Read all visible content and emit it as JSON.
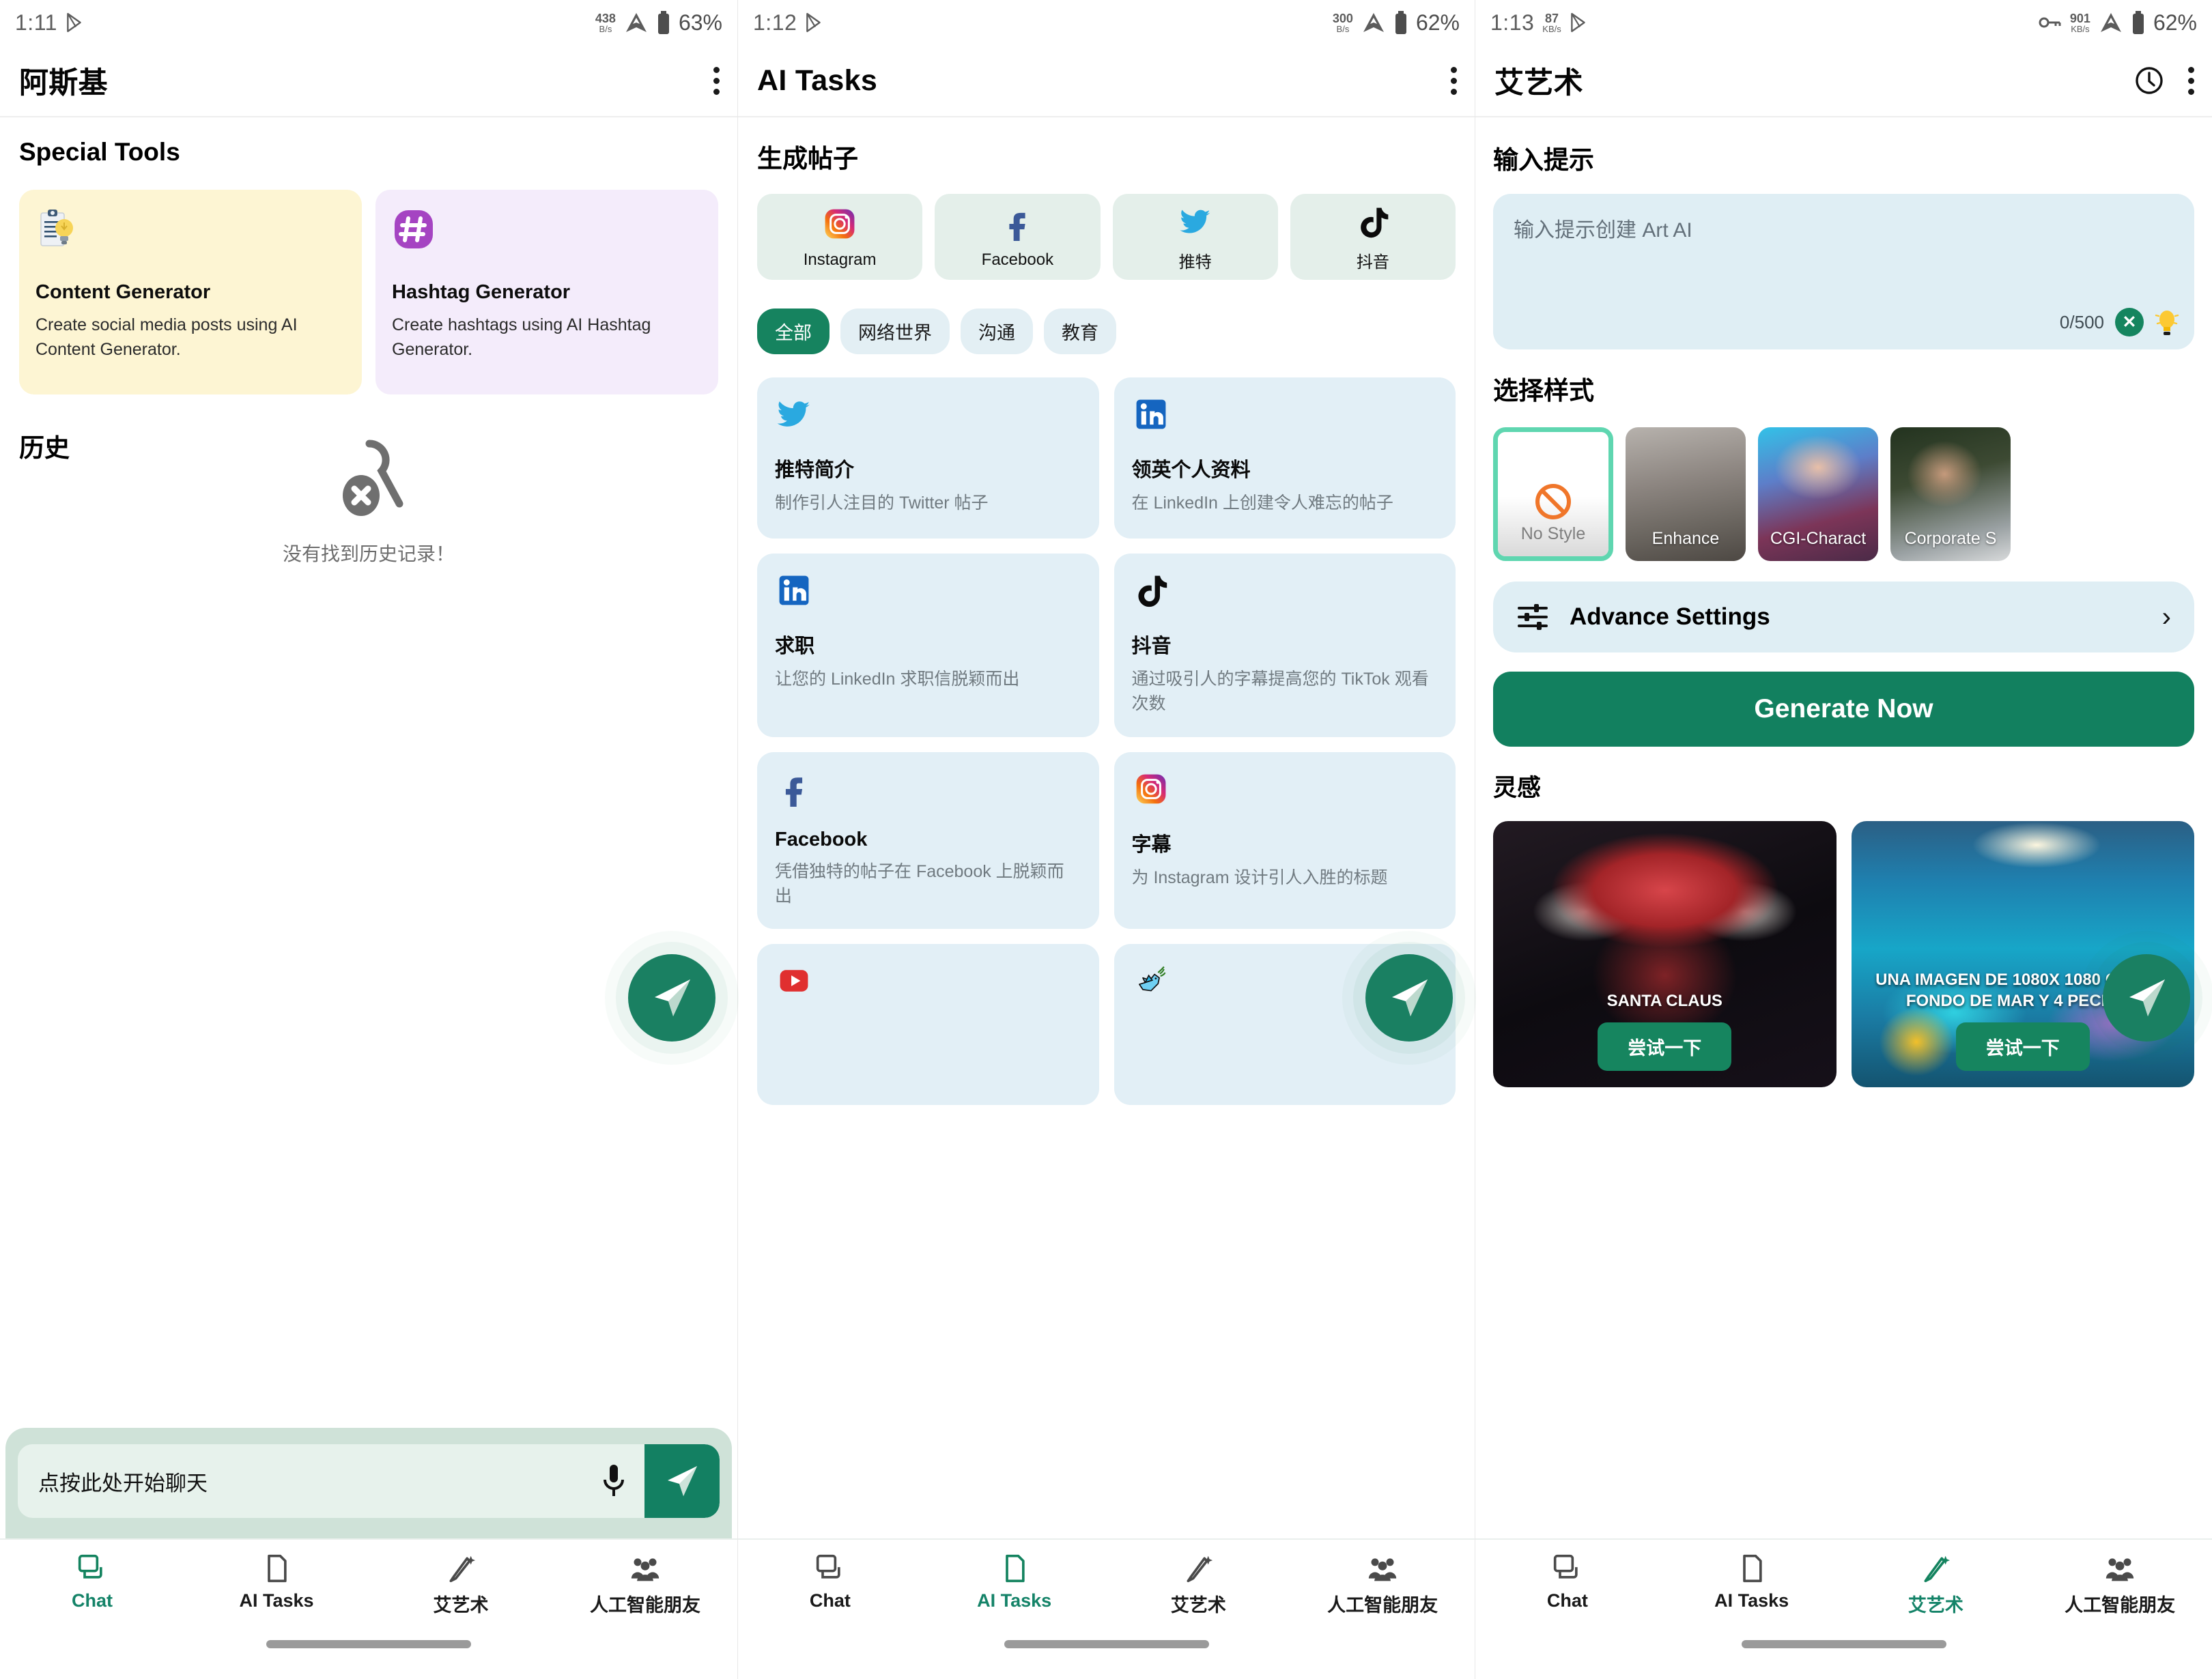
{
  "screens": [
    {
      "status": {
        "time": "1:11",
        "net_value": "438",
        "net_unit": "B/s",
        "battery": "63%"
      },
      "appbar": {
        "title": "阿斯基"
      },
      "special_tools_title": "Special Tools",
      "tools": [
        {
          "name": "Content Generator",
          "desc": "Create social media posts using AI Content Generator."
        },
        {
          "name": "Hashtag Generator",
          "desc": "Create hashtags using AI Hashtag Generator."
        }
      ],
      "history_title": "历史",
      "empty_text": "没有找到历史记录！",
      "chat_placeholder": "点按此处开始聊天"
    },
    {
      "status": {
        "time": "1:12",
        "net_value": "300",
        "net_unit": "B/s",
        "battery": "62%"
      },
      "appbar": {
        "title": "AI Tasks"
      },
      "section_title": "生成帖子",
      "platforms": [
        {
          "label": "Instagram",
          "icon": "instagram-icon"
        },
        {
          "label": "Facebook",
          "icon": "facebook-icon"
        },
        {
          "label": "推特",
          "icon": "twitter-icon"
        },
        {
          "label": "抖音",
          "icon": "tiktok-icon"
        }
      ],
      "chips": [
        {
          "label": "全部",
          "selected": true
        },
        {
          "label": "网络世界",
          "selected": false
        },
        {
          "label": "沟通",
          "selected": false
        },
        {
          "label": "教育",
          "selected": false
        }
      ],
      "cards": [
        {
          "name": "推特简介",
          "desc": "制作引人注目的 Twitter 帖子",
          "icon": "twitter-icon"
        },
        {
          "name": "领英个人资料",
          "desc": "在 LinkedIn 上创建令人难忘的帖子",
          "icon": "linkedin-icon"
        },
        {
          "name": "求职",
          "desc": "让您的 LinkedIn 求职信脱颖而出",
          "icon": "linkedin-icon"
        },
        {
          "name": "抖音",
          "desc": "通过吸引人的字幕提高您的 TikTok 观看次数",
          "icon": "tiktok-icon"
        },
        {
          "name": "Facebook",
          "desc": "凭借独特的帖子在 Facebook 上脱颖而出",
          "icon": "facebook-icon"
        },
        {
          "name": "字幕",
          "desc": "为 Instagram 设计引人入胜的标题",
          "icon": "instagram-icon"
        },
        {
          "name": "",
          "desc": "",
          "icon": "youtube-icon"
        },
        {
          "name": "",
          "desc": "",
          "icon": "dove-icon"
        }
      ]
    },
    {
      "status": {
        "time": "1:13",
        "net_value": "87",
        "net_unit": "KB/s",
        "battery": "62%",
        "right_net_value": "901",
        "right_net_unit": "KB/s"
      },
      "appbar": {
        "title": "艾艺术"
      },
      "prompt_title": "输入提示",
      "prompt_placeholder": "输入提示创建 Art AI",
      "prompt_count": "0/500",
      "styles_title": "选择样式",
      "styles": [
        {
          "label": "No Style",
          "selected": true
        },
        {
          "label": "Enhance",
          "selected": false
        },
        {
          "label": "CGI-Charact",
          "selected": false
        },
        {
          "label": "Corporate S",
          "selected": false
        }
      ],
      "advance_label": "Advance Settings",
      "generate_label": "Generate Now",
      "inspiration_title": "灵感",
      "inspirations": [
        {
          "caption": "SANTA CLAUS",
          "try_label": "尝试一下"
        },
        {
          "caption": "UNA IMAGEN DE 1080X 1080 CON UN FONDO DE MAR Y 4 PECES…",
          "try_label": "尝试一下"
        }
      ]
    }
  ],
  "bottom_nav": [
    {
      "label": "Chat",
      "icon": "chat-icon"
    },
    {
      "label": "AI Tasks",
      "icon": "document-icon"
    },
    {
      "label": "艾艺术",
      "icon": "magic-pen-icon"
    },
    {
      "label": "人工智能朋友",
      "icon": "people-icon"
    }
  ],
  "active_tab": [
    0,
    1,
    2
  ],
  "colors": {
    "accent": "#14835f",
    "chip_bg": "#e3eff4",
    "card_bg": "#e2eff6",
    "platform_bg": "#e4efea",
    "selected_style_border": "#5fd6b0"
  }
}
